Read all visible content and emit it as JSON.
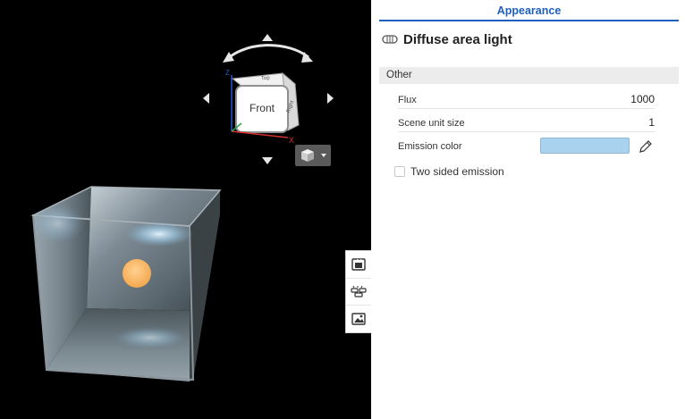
{
  "panel": {
    "tab_label": "Appearance",
    "title": "Diffuse area light",
    "section_label": "Other",
    "properties": [
      {
        "label": "Flux",
        "value": "1000"
      },
      {
        "label": "Scene unit size",
        "value": "1"
      },
      {
        "label": "Emission color",
        "value": ""
      }
    ],
    "emission_color_hex": "#a9d2ee",
    "two_sided_emission": {
      "label": "Two sided emission",
      "checked": false
    }
  },
  "view_cube": {
    "faces": {
      "front": "Front",
      "top": "Top",
      "right": "Right"
    },
    "axes": {
      "x": "X",
      "z": "Z"
    }
  },
  "viewport": {
    "background": "#000000",
    "light_color": "#f9b25a"
  },
  "icons": {
    "title_icon": "area-light-icon",
    "view_dropdown": "cube-view-dropdown-icon",
    "side_tools": [
      "render-settings-icon",
      "scene-lights-icon",
      "environment-icon"
    ],
    "edit_color": "pencil-icon"
  }
}
